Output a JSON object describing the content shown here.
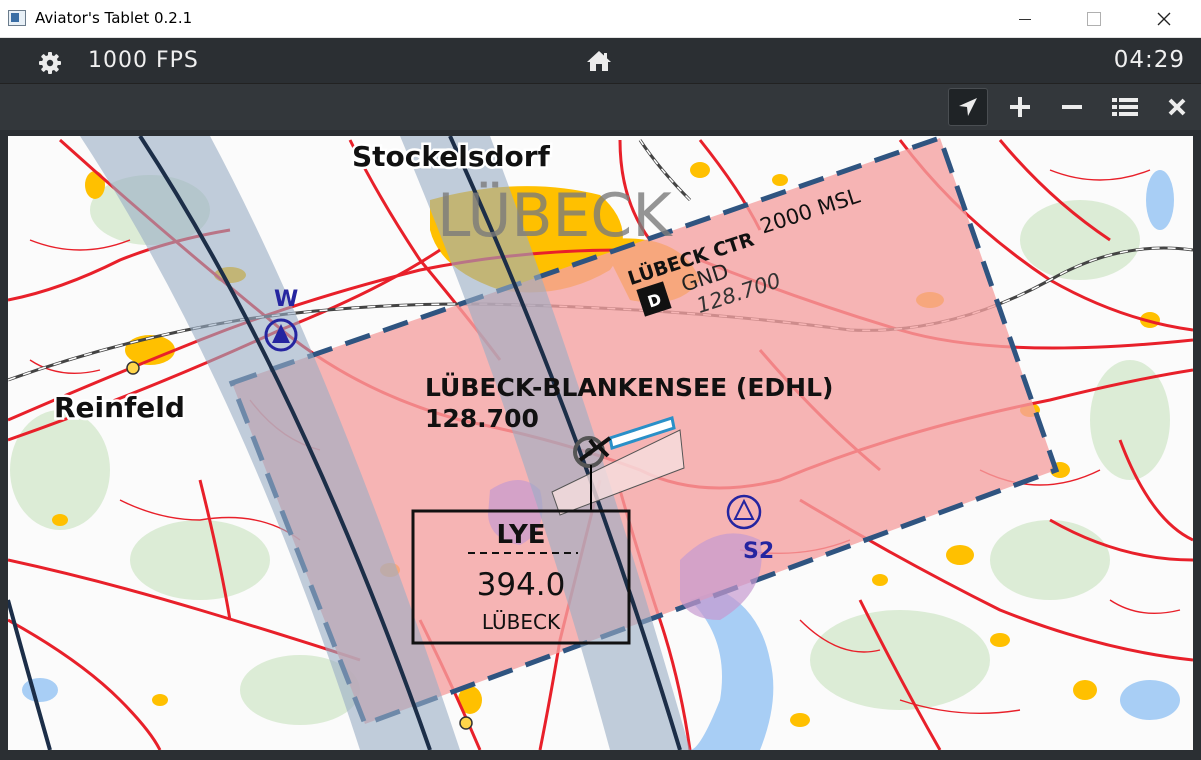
{
  "window": {
    "title": "Aviator's Tablet  0.2.1",
    "minimize_icon": "minimize-icon",
    "maximize_icon": "maximize-icon",
    "close_icon": "close-icon"
  },
  "topbar": {
    "settings_icon": "gear-icon",
    "fps": "1000 FPS",
    "home_icon": "home-icon",
    "clock": "04:29"
  },
  "toolbar": {
    "buttons": [
      {
        "icon": "navigation-arrow-icon",
        "active": true
      },
      {
        "icon": "zoom-in-icon"
      },
      {
        "icon": "zoom-out-icon"
      },
      {
        "icon": "list-icon"
      },
      {
        "icon": "close-icon"
      }
    ]
  },
  "map": {
    "city_big": "LÜBECK",
    "towns": [
      "Stockelsdorf",
      "Reinfeld"
    ],
    "airspace": {
      "name": "LÜBECK CTR",
      "lower": "GND",
      "upper": "2000 MSL",
      "frequency": "128.700",
      "class": "D"
    },
    "airport": {
      "name": "LÜBECK-BLANKENSEE (EDHL)",
      "frequency": "128.700"
    },
    "waypoints": [
      "W",
      "S2"
    ],
    "navaid": {
      "ident": "LYE",
      "frequency": "394.0",
      "name": "LÜBECK"
    },
    "colors": {
      "ctr_fill": "#f5a0a0",
      "ctr_border": "#2f5480",
      "road": "#e8202a",
      "town": "#ffc000",
      "corridor": "#9aaec4",
      "water": "#a8cef5"
    }
  }
}
